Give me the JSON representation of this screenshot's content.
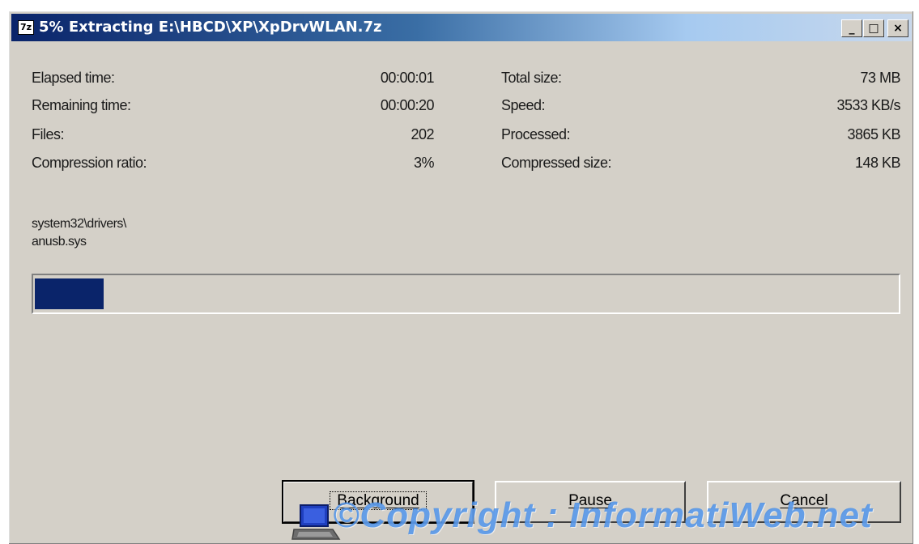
{
  "window": {
    "title": "5% Extracting E:\\HBCD\\XP\\XpDrvWLAN.7z",
    "app_icon_text": "7z",
    "controls": {
      "minimize_icon": "minimize-icon",
      "maximize_icon": "maximize-icon",
      "close_icon": "close-icon",
      "minimize": "_",
      "maximize": "□",
      "close": "×"
    }
  },
  "stats": {
    "left": [
      {
        "label": "Elapsed time:",
        "value": "00:00:01"
      },
      {
        "label": "Remaining time:",
        "value": "00:00:20"
      },
      {
        "label": "Files:",
        "value": "202"
      },
      {
        "label": "Compression ratio:",
        "value": "3%"
      }
    ],
    "right": [
      {
        "label": "Total size:",
        "value": "73 MB"
      },
      {
        "label": "Speed:",
        "value": "3533 KB/s"
      },
      {
        "label": "Processed:",
        "value": "3865 KB"
      },
      {
        "label": "Compressed size:",
        "value": "148 KB"
      }
    ]
  },
  "current_file": {
    "line1": "system32\\drivers\\",
    "line2": "anusb.sys"
  },
  "progress": {
    "percent": 5,
    "fill_color": "#0a246a"
  },
  "buttons": {
    "background": "Background",
    "pause": "Pause",
    "cancel": "Cancel"
  },
  "watermark": {
    "text": "©Copyright : InformatiWeb.net",
    "icon": "laptop-icon"
  },
  "colors": {
    "titlebar_start": "#0a246a",
    "titlebar_end": "#a6caf0",
    "face": "#d4d0c8"
  }
}
